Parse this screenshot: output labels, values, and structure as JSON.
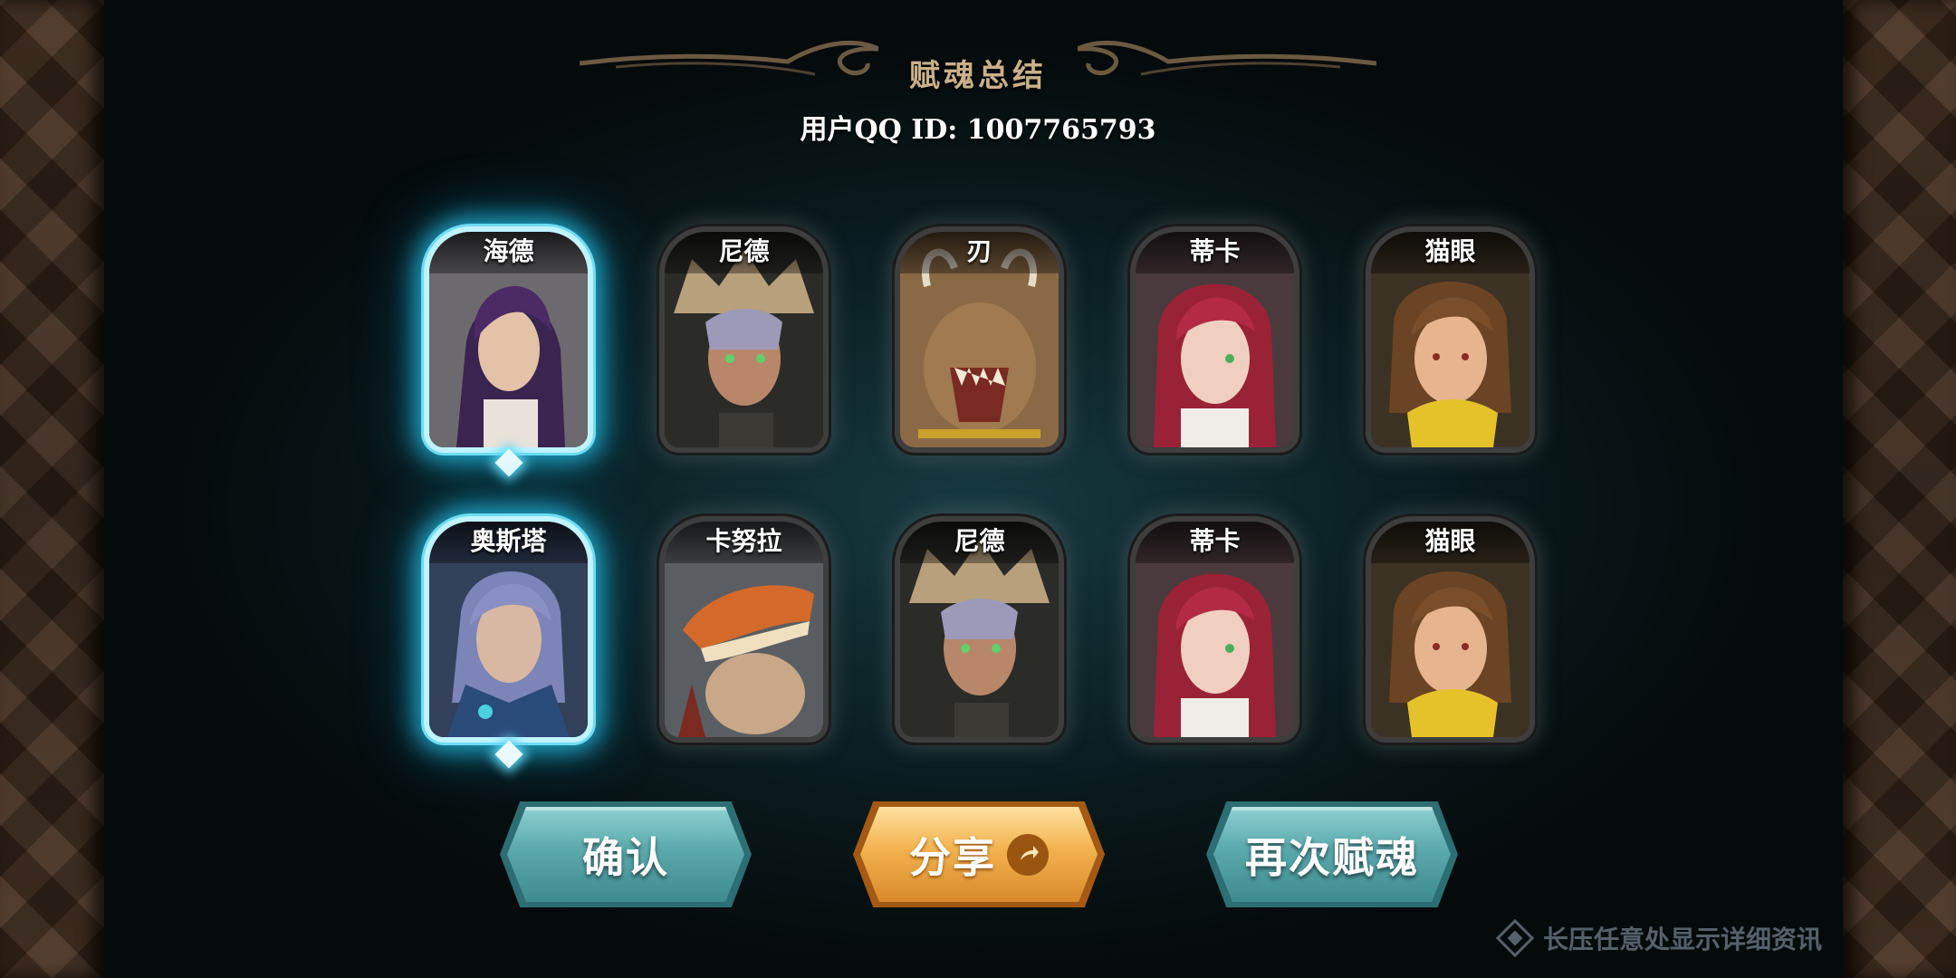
{
  "title": "赋魂总结",
  "user_id_text": "用户QQ ID: 1007765793",
  "cards_row1": [
    {
      "name": "海德",
      "selected": true
    },
    {
      "name": "尼德",
      "selected": false
    },
    {
      "name": "刃",
      "selected": false
    },
    {
      "name": "蒂卡",
      "selected": false
    },
    {
      "name": "猫眼",
      "selected": false
    }
  ],
  "cards_row2": [
    {
      "name": "奥斯塔",
      "selected": true
    },
    {
      "name": "卡努拉",
      "selected": false
    },
    {
      "name": "尼德",
      "selected": false
    },
    {
      "name": "蒂卡",
      "selected": false
    },
    {
      "name": "猫眼",
      "selected": false
    }
  ],
  "buttons": {
    "confirm": "确认",
    "share": "分享",
    "reroll": "再次赋魂"
  },
  "hint": "长压任意处显示详细资讯",
  "colors": {
    "selected_glow": "#28c8f0",
    "title": "#c9b08a",
    "teal_button": "#5aa9ad",
    "gold_button": "#f2b24e"
  }
}
